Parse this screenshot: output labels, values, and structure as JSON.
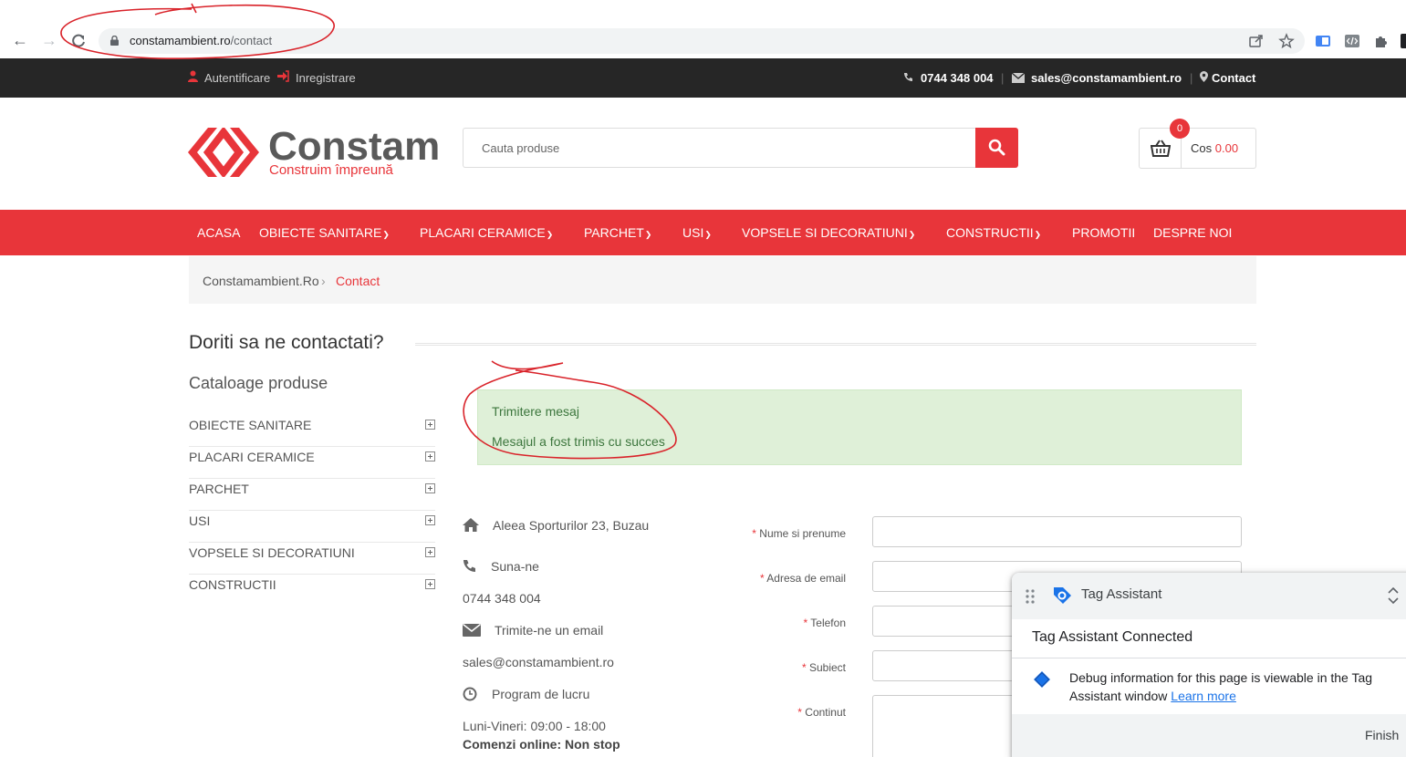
{
  "browser": {
    "url_domain": "constamambient.ro",
    "url_path": "/contact"
  },
  "topbar": {
    "login": "Autentificare",
    "register": "Inregistrare",
    "phone": "0744 348 004",
    "email": "sales@constamambient.ro",
    "contact": "Contact",
    "separator": "|"
  },
  "header": {
    "logo_name": "Constam",
    "logo_tagline": "Construim împreună",
    "search_placeholder": "Cauta produse",
    "cart_count": "0",
    "cart_label": "Cos",
    "cart_amount": "0.00"
  },
  "nav": {
    "items": [
      {
        "label": "ACASA"
      },
      {
        "label": "OBIECTE SANITARE"
      },
      {
        "label": "PLACARI CERAMICE"
      },
      {
        "label": "PARCHET"
      },
      {
        "label": "USI"
      },
      {
        "label": "VOPSELE SI DECORATIUNI"
      },
      {
        "label": "CONSTRUCTII"
      },
      {
        "label": "PROMOTII"
      },
      {
        "label": "DESPRE NOI"
      }
    ]
  },
  "breadcrumb": {
    "home": "Constamambient.Ro",
    "separator": "›",
    "current": "Contact"
  },
  "page": {
    "title": "Doriti sa ne contactati?"
  },
  "sidebar": {
    "title": "Cataloage produse",
    "items": [
      {
        "label": "OBIECTE SANITARE"
      },
      {
        "label": "PLACARI CERAMICE"
      },
      {
        "label": "PARCHET"
      },
      {
        "label": "USI"
      },
      {
        "label": "VOPSELE SI DECORATIUNI"
      },
      {
        "label": "CONSTRUCTII"
      }
    ]
  },
  "alert": {
    "title": "Trimitere mesaj",
    "message": "Mesajul a fost trimis cu succes"
  },
  "contact_info": {
    "address": "Aleea Sporturilor 23, Buzau",
    "call_label": "Suna-ne",
    "phone": "0744 348 004",
    "email_label": "Trimite-ne un email",
    "email": "sales@constamambient.ro",
    "schedule_label": "Program de lucru",
    "schedule_hours": "Luni-Vineri: 09:00 - 18:00",
    "online_orders": "Comenzi online: Non stop"
  },
  "form": {
    "required_mark": "*",
    "fields": [
      {
        "label": "Nume si prenume"
      },
      {
        "label": "Adresa de email"
      },
      {
        "label": "Telefon"
      },
      {
        "label": "Subiect"
      },
      {
        "label": "Continut"
      }
    ]
  },
  "tag_assistant": {
    "title": "Tag Assistant",
    "status": "Tag Assistant Connected",
    "message": "Debug information for this page is viewable in the Tag Assistant window",
    "learn_more": "Learn more",
    "finish": "Finish"
  },
  "colors": {
    "brand_red": "#e8353a",
    "topbar_bg": "#262626",
    "alert_bg": "#dff0d8",
    "alert_text": "#3c763d"
  }
}
